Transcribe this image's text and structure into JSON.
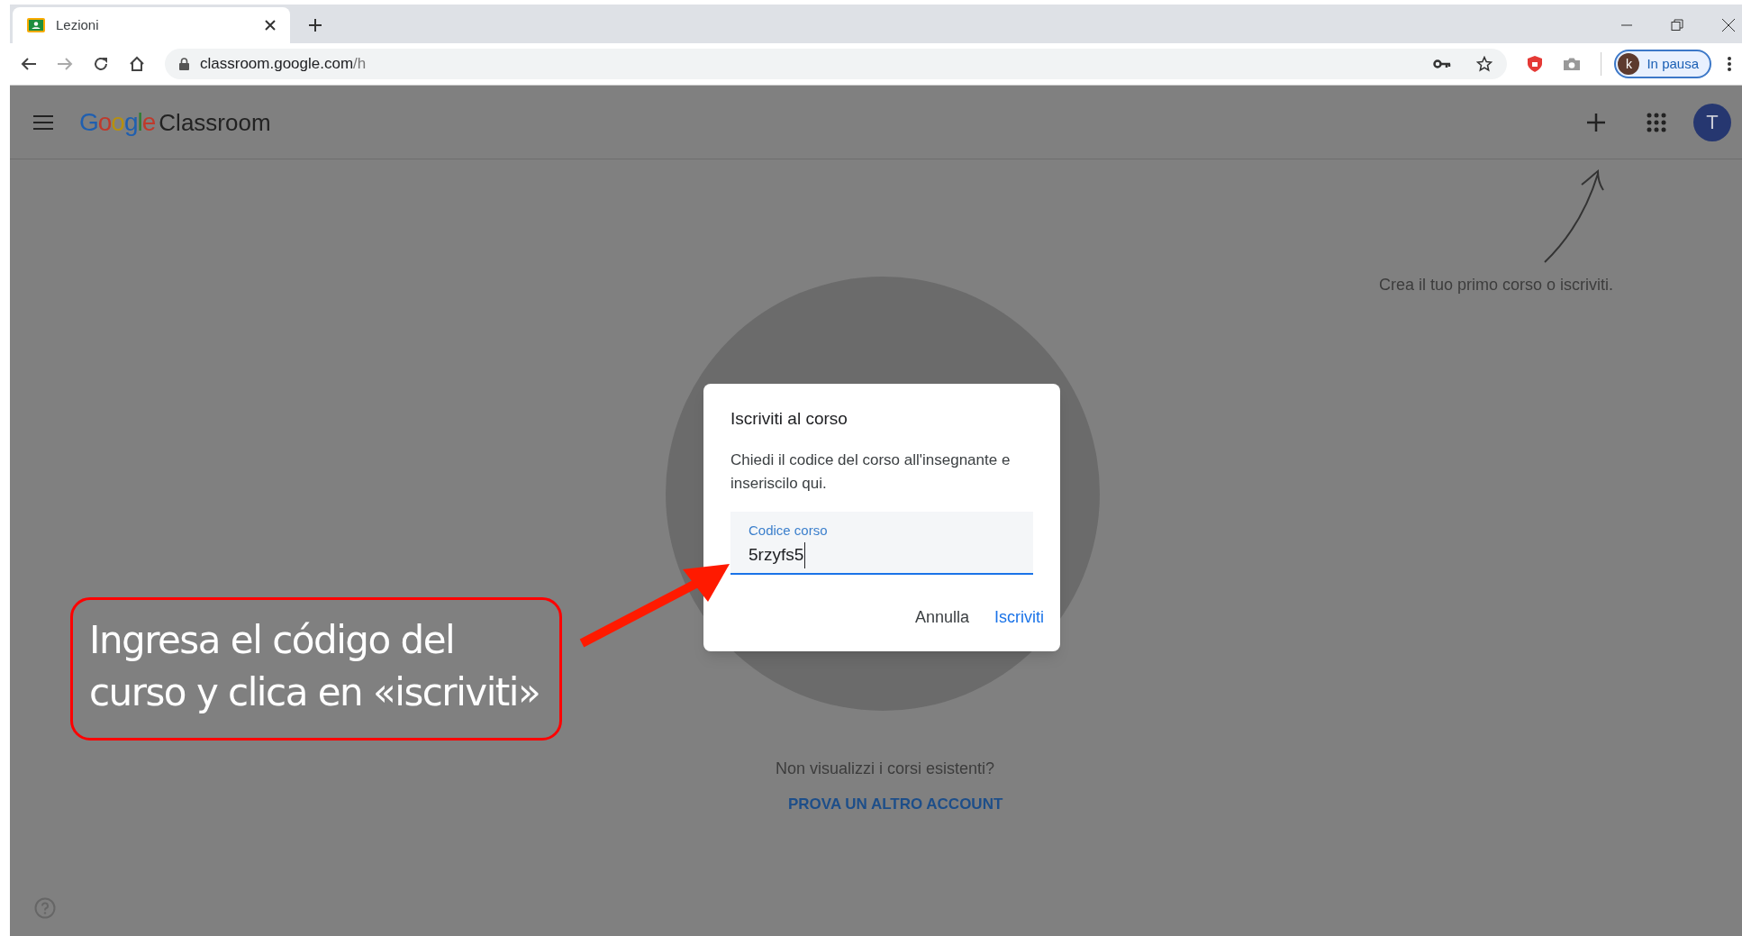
{
  "browser": {
    "tab": {
      "title": "Lezioni",
      "selected": true
    },
    "url_host": "classroom.google.com",
    "url_path": "/h",
    "profile": {
      "initial": "k",
      "label": "In pausa"
    }
  },
  "app": {
    "logo_brand": "Google",
    "logo_product": "Classroom",
    "avatar": "T",
    "hint": "Crea il tuo primo corso o iscriviti.",
    "no_courses": "Non visualizzi i corsi esistenti?",
    "other_account": "PROVA UN ALTRO ACCOUNT"
  },
  "dialog": {
    "title": "Iscriviti al corso",
    "body": "Chiedi il codice del corso all'insegnante e inseriscilo qui.",
    "field": {
      "label": "Codice corso",
      "value": "5rzyfs5",
      "focused": true
    },
    "buttons": [
      {
        "label": "Annulla",
        "primary": false
      },
      {
        "label": "Iscriviti",
        "primary": true
      }
    ]
  },
  "callout": {
    "text": "Ingresa el código del curso  y clica en «iscriviti»"
  }
}
